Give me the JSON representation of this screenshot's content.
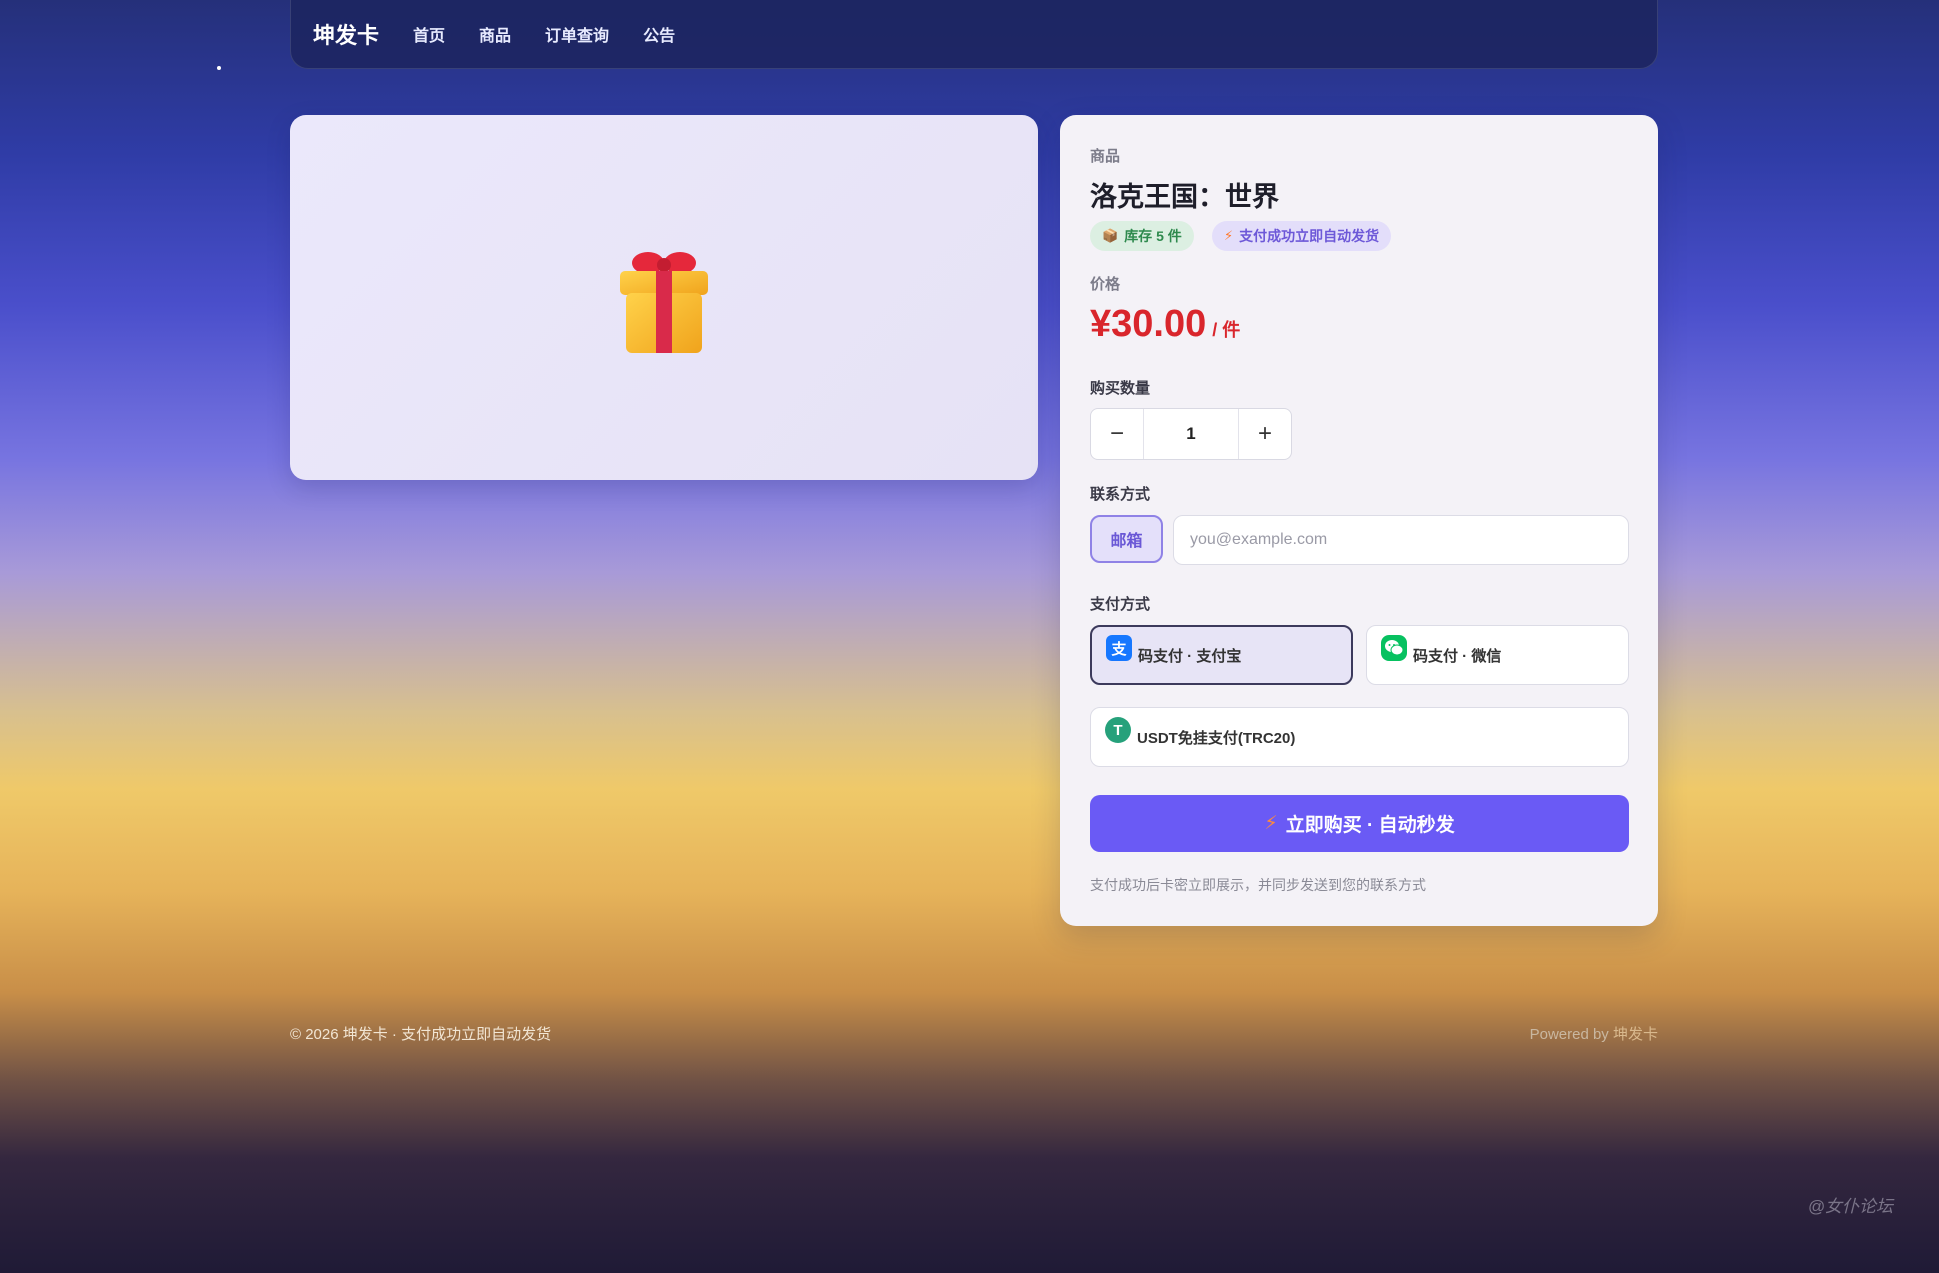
{
  "nav": {
    "brand": "坤发卡",
    "links": [
      "首页",
      "商品",
      "订单查询",
      "公告"
    ]
  },
  "product": {
    "section_label": "商品",
    "title": "洛克王国：世界",
    "stock_badge": "库存 5 件",
    "auto_badge": "支付成功立即自动发货",
    "price_label": "价格",
    "price": "¥30.00",
    "price_unit": "/ 件"
  },
  "quantity": {
    "label": "购买数量",
    "minus": "−",
    "value": "1",
    "plus": "+"
  },
  "contact": {
    "label": "联系方式",
    "tab": "邮箱",
    "placeholder": "you@example.com"
  },
  "payment": {
    "label": "支付方式",
    "options": [
      {
        "label": "码支付 · 支付宝",
        "icon": "alipay-icon",
        "icon_char": "支",
        "selected": true
      },
      {
        "label": "码支付 · 微信",
        "icon": "wechat-icon",
        "selected": false
      },
      {
        "label": "USDT免挂支付(TRC20)",
        "icon": "usdt-icon",
        "icon_char": "T",
        "selected": false
      }
    ]
  },
  "buy_button": "立即购买 · 自动秒发",
  "note": "支付成功后卡密立即展示，并同步发送到您的联系方式",
  "footer": {
    "left": "© 2026 坤发卡 · 支付成功立即自动发货",
    "powered_prefix": "Powered by ",
    "powered_brand": "坤发卡"
  },
  "watermark": "@女仆论坛",
  "colors": {
    "accent": "#6a5af5",
    "price": "#d9262c",
    "stock_badge": "#2f8a4e",
    "alipay": "#1677ff",
    "wechat": "#07c160",
    "usdt": "#26a17b"
  }
}
